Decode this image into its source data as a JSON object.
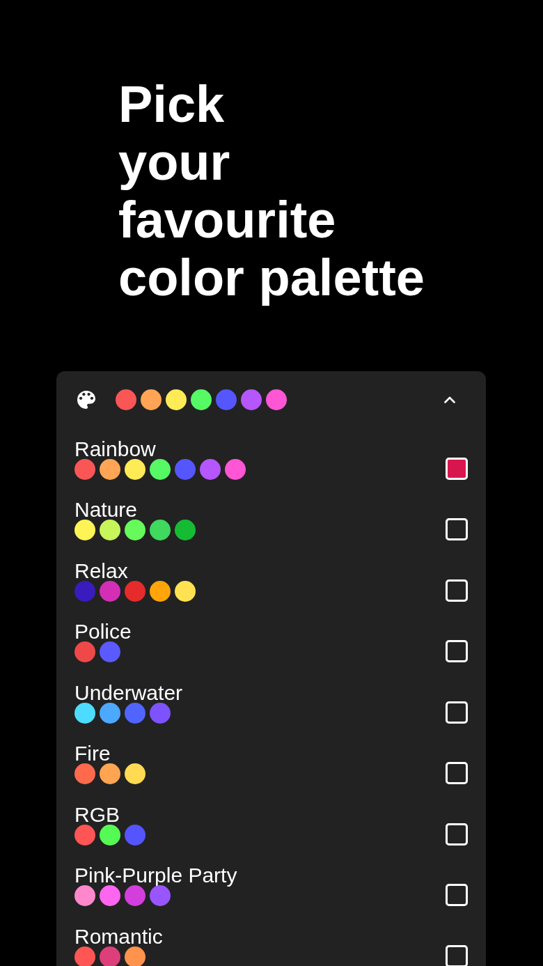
{
  "heading": "Pick\nyour\nfavourite\ncolor palette",
  "palette_picker": {
    "expanded": true,
    "preview_colors": [
      {
        "color": "#fb5656"
      },
      {
        "color": "#ffa555"
      },
      {
        "color": "#ffeb55"
      },
      {
        "color": "#56fa64"
      },
      {
        "color": "#5656ff"
      },
      {
        "color": "#b556ff"
      },
      {
        "color": "#ff56d5"
      }
    ],
    "palettes": [
      {
        "name": "Rainbow",
        "selected": true,
        "colors": [
          {
            "color": "#fb5656"
          },
          {
            "color": "#ffa555"
          },
          {
            "color": "#ffeb55"
          },
          {
            "color": "#56fa64"
          },
          {
            "color": "#5656ff"
          },
          {
            "color": "#b556ff"
          },
          {
            "color": "#ff56d5"
          }
        ]
      },
      {
        "name": "Nature",
        "selected": false,
        "colors": [
          {
            "color": "#fff455"
          },
          {
            "color": "#c8f55a"
          },
          {
            "color": "#66fa5a"
          },
          {
            "color": "#3ed95d"
          },
          {
            "color": "#16bb34"
          }
        ]
      },
      {
        "name": "Relax",
        "selected": false,
        "colors": [
          {
            "color": "#3a1bbd"
          },
          {
            "color": "#d22fb5"
          },
          {
            "color": "#e52b2b"
          },
          {
            "color": "#ffa50a"
          },
          {
            "color": "#ffe252"
          }
        ]
      },
      {
        "name": "Police",
        "selected": false,
        "colors": [
          {
            "color": "#ef4848"
          },
          {
            "color": "#5a5aff"
          }
        ]
      },
      {
        "name": "Underwater",
        "selected": false,
        "colors": [
          {
            "color": "#4ddcff"
          },
          {
            "color": "#4da8ff"
          },
          {
            "color": "#5065ff"
          },
          {
            "color": "#7d52ff"
          }
        ]
      },
      {
        "name": "Fire",
        "selected": false,
        "colors": [
          {
            "color": "#ff6a4d"
          },
          {
            "color": "#ffa552"
          },
          {
            "color": "#ffda52"
          }
        ]
      },
      {
        "name": "RGB",
        "selected": false,
        "colors": [
          {
            "color": "#ff5555"
          },
          {
            "color": "#55fa55"
          },
          {
            "color": "#5555ff"
          }
        ]
      },
      {
        "name": "Pink-Purple Party",
        "selected": false,
        "colors": [
          {
            "color": "#ff88cc"
          },
          {
            "color": "#ff66f0"
          },
          {
            "color": "#d23fdc"
          },
          {
            "color": "#9955ff"
          }
        ]
      },
      {
        "name": "Romantic",
        "selected": false,
        "colors": [
          {
            "color": "#ff5555"
          },
          {
            "color": "#dd3f7a"
          },
          {
            "color": "#ff934d"
          }
        ]
      }
    ]
  }
}
